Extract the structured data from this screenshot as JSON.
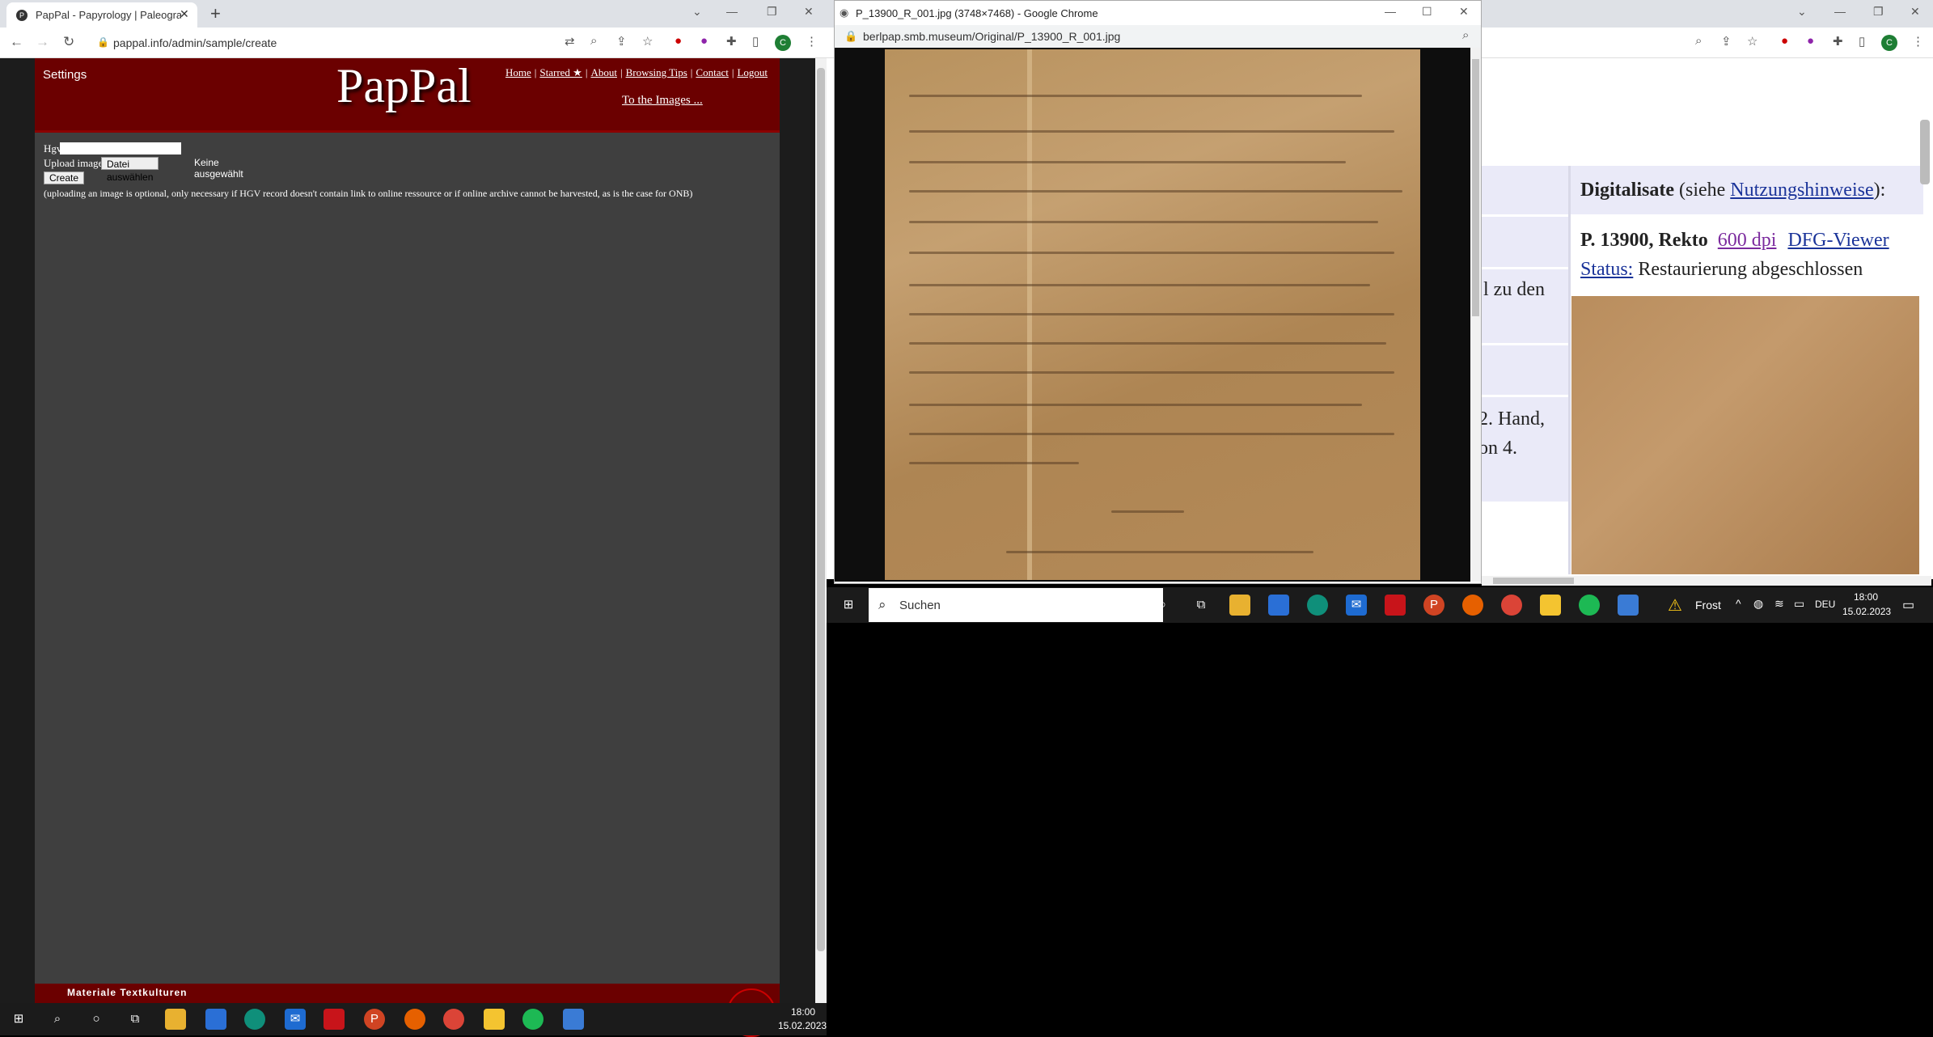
{
  "left_browser": {
    "tab_title": "PapPal - Papyrology | Paleography",
    "url": "pappal.info/admin/sample/create",
    "avatar_letter": "C"
  },
  "pappal": {
    "settings": "Settings",
    "logo": "PapPal",
    "nav": [
      "Home",
      "Starred ★",
      "About",
      "Browsing Tips",
      "Contact",
      "Logout"
    ],
    "to_images": "To the Images ...",
    "hgv_label": "Hgv",
    "upload_label": "Upload image",
    "file_button": "Datei auswählen",
    "no_file": "Keine ausgewählt",
    "create_button": "Create",
    "note": "(uploading an image is optional, only necessary if HGV record doesn't contain link to online ressource or if online archive cannot be harvested, as is the case for ONB)",
    "footer_text": "Materiale Textkulturen"
  },
  "popup": {
    "title": "P_13900_R_001.jpg (3748×7468) - Google Chrome",
    "url": "berlpap.smb.museum/Original/P_13900_R_001.jpg"
  },
  "right_page": {
    "digitalisate_label": "Digitalisate",
    "digitalisate_paren_open": "(siehe ",
    "nutzungshinweise": "Nutzungshinweise",
    "digitalisate_paren_close": "):",
    "item_title": "P. 13900, Rekto",
    "dpi_link": "600 dpi",
    "viewer_link": "DFG-Viewer",
    "status_label": "Status:",
    "status_value": "Restaurierung abgeschlossen",
    "frag1": "l zu den",
    "frag2": "2. Hand,",
    "frag3": "on 4."
  },
  "taskbar_right": {
    "search_placeholder": "Suchen",
    "weather": "Frost",
    "lang": "DEU",
    "time": "18:00",
    "date": "15.02.2023"
  },
  "taskbar_left": {
    "time": "18:00",
    "date": "15.02.2023"
  },
  "colors": {
    "header_red": "#6b0000",
    "content_gray": "#3f3f3f",
    "link_blue": "#1a3399"
  }
}
